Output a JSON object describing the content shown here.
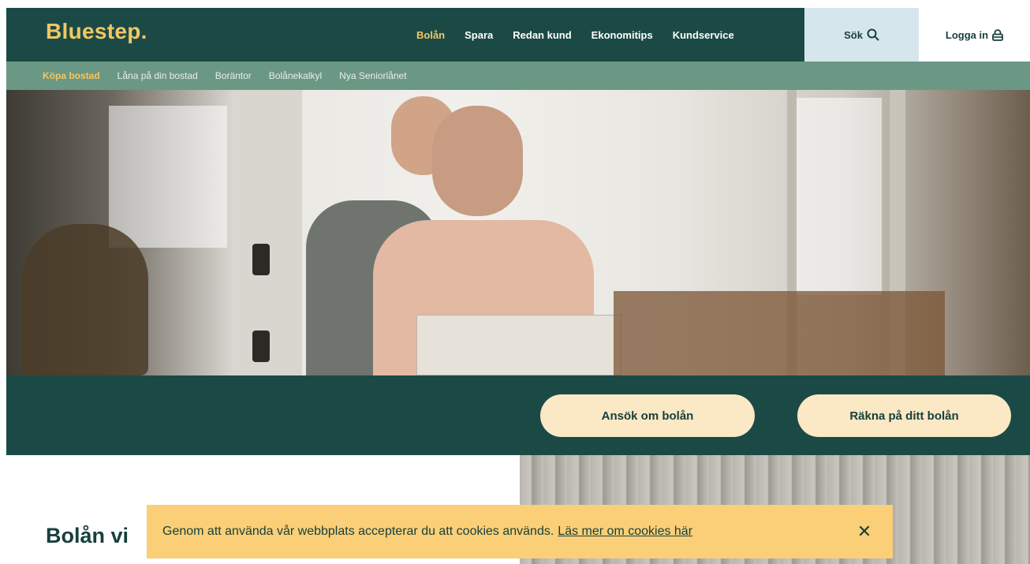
{
  "brand": {
    "logo_text": "Bluestep."
  },
  "main_nav": [
    {
      "label": "Bolån",
      "active": true
    },
    {
      "label": "Spara",
      "active": false
    },
    {
      "label": "Redan kund",
      "active": false
    },
    {
      "label": "Ekonomitips",
      "active": false
    },
    {
      "label": "Kundservice",
      "active": false
    }
  ],
  "header_actions": {
    "search_label": "Sök",
    "login_label": "Logga in"
  },
  "sub_nav": [
    {
      "label": "Köpa bostad",
      "active": true
    },
    {
      "label": "Låna på din bostad",
      "active": false
    },
    {
      "label": "Boräntor",
      "active": false
    },
    {
      "label": "Bolånekalkyl",
      "active": false
    },
    {
      "label": "Nya Seniorlånet",
      "active": false
    }
  ],
  "cta": {
    "apply_label": "Ansök om bolån",
    "calculate_label": "Räkna på ditt bolån"
  },
  "content": {
    "title": "Bolån vi"
  },
  "cookie_banner": {
    "text": "Genom att använda vår webbplats accepterar du att cookies används.",
    "link_text": "Läs mer om cookies här",
    "close_symbol": "✕"
  },
  "colors": {
    "primary": "#1b4a46",
    "accent": "#f5c661",
    "subnav": "#6b9885",
    "cta_bg": "#fbe8c4",
    "cookie_bg": "#fbcf77",
    "search_bg": "#d6e6ed"
  },
  "icons": {
    "search": "search-icon",
    "login": "lock-icon",
    "close": "close-icon"
  }
}
